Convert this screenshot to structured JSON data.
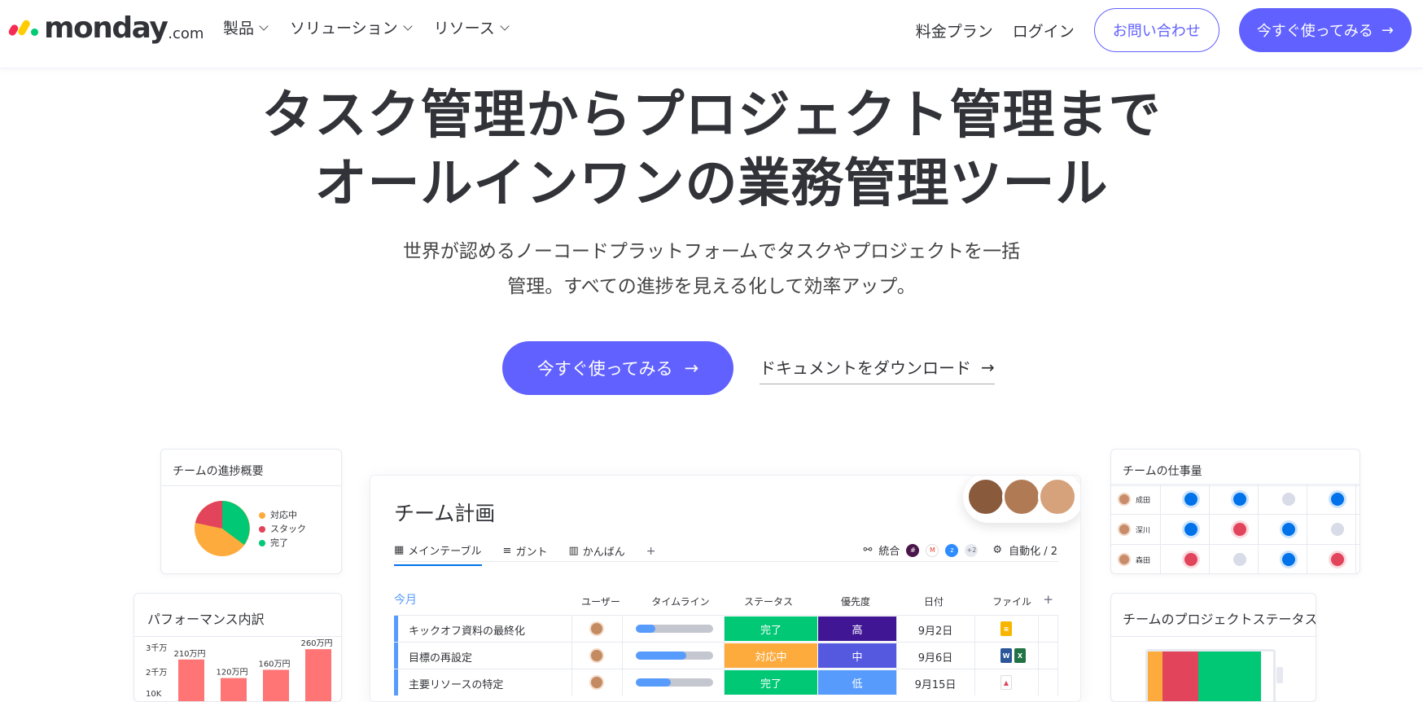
{
  "nav": {
    "logo_word": "monday",
    "logo_domain": ".com",
    "menu": [
      "製品",
      "ソリューション",
      "リソース"
    ],
    "pricing": "料金プラン",
    "login": "ログイン",
    "contact": "お問い合わせ",
    "start": "今すぐ使ってみる",
    "arrow": "→"
  },
  "hero": {
    "headline_line1": "タスク管理からプロジェクト管理まで",
    "headline_line2": "オールインワンの業務管理ツール",
    "sub_line1": "世界が認めるノーコードプラットフォームでタスクやプロジェクトを一括",
    "sub_line2": "管理。すべての進捗を見える化して効率アップ。",
    "cta": "今すぐ使ってみる",
    "doc_link": "ドキュメントをダウンロード"
  },
  "progress_card": {
    "title": "チームの進捗概要",
    "legend": [
      {
        "label": "対応中",
        "color": "#fdab3d"
      },
      {
        "label": "スタック",
        "color": "#e2445c"
      },
      {
        "label": "完了",
        "color": "#00c875"
      }
    ]
  },
  "perf_card": {
    "title": "パフォーマンス内訳"
  },
  "chart_data": {
    "type": "bar",
    "categories": [
      "",
      "",
      "",
      ""
    ],
    "values": [
      2100000,
      1200000,
      1600000,
      2600000
    ],
    "data_labels": [
      "210万円",
      "120万円",
      "160万円",
      "260万円"
    ],
    "y_ticks": [
      "3千万",
      "2千万",
      "10K"
    ],
    "color": "#ff7575"
  },
  "workload_card": {
    "title": "チームの仕事量",
    "rows": [
      {
        "name": "成田",
        "dots": [
          "#0073ea",
          "#0073ea",
          "#d8dbe8",
          "#0073ea"
        ]
      },
      {
        "name": "深川",
        "dots": [
          "#0073ea",
          "#e2445c",
          "#0073ea",
          "#d8dbe8"
        ]
      },
      {
        "name": "森田",
        "dots": [
          "#e2445c",
          "#d8dbe8",
          "#0073ea",
          "#e2445c"
        ]
      }
    ]
  },
  "project_card": {
    "title": "チームのプロジェクトステータス"
  },
  "board": {
    "title": "チーム計画",
    "tabs": [
      "メインテーブル",
      "ガント",
      "かんばん",
      "+"
    ],
    "integrate": "統合",
    "integrate_more": "+2",
    "automate": "自動化 / 2",
    "group": "今月",
    "columns": [
      "ユーザー",
      "タイムライン",
      "ステータス",
      "優先度",
      "日付",
      "ファイル",
      "+"
    ],
    "rows": [
      {
        "name": "キックオフ資料の最終化",
        "timeline": 0.25,
        "status": "完了",
        "status_color": "#00c875",
        "priority": "高",
        "priority_color": "#401694",
        "date": "9月2日"
      },
      {
        "name": "目標の再設定",
        "timeline": 0.65,
        "status": "対応中",
        "status_color": "#fdab3d",
        "priority": "中",
        "priority_color": "#5559df",
        "date": "9月6日"
      },
      {
        "name": "主要リソースの特定",
        "timeline": 0.45,
        "status": "完了",
        "status_color": "#00c875",
        "priority": "低",
        "priority_color": "#579bfc",
        "date": "9月15日"
      }
    ]
  }
}
